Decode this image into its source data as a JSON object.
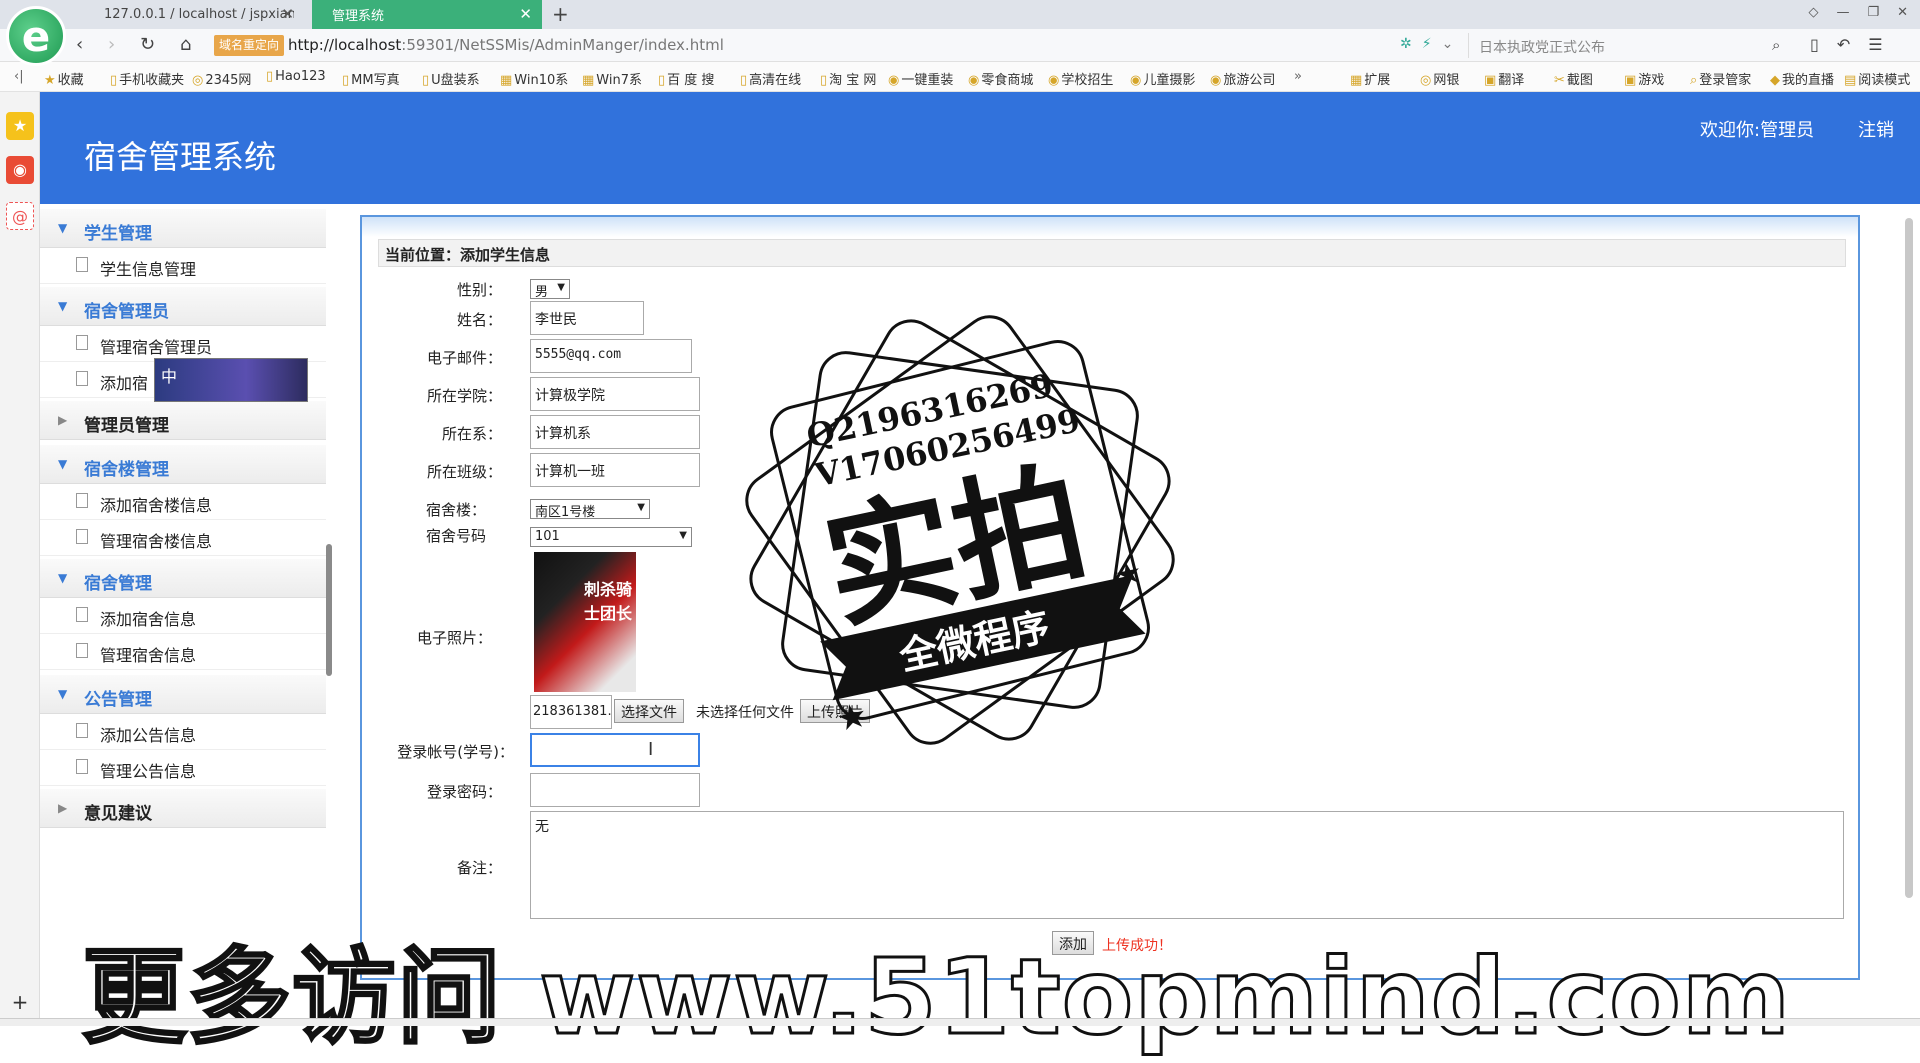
{
  "browser": {
    "tabs": [
      {
        "label": "127.0.0.1 / localhost / jspxian"
      },
      {
        "label": "管理系统"
      }
    ],
    "redirect_badge": "域名重定向",
    "url_host": "http://localhost",
    "url_rest": ":59301/NetSSMis/AdminManger/index.html",
    "search_placeholder": "日本执政党正式公布",
    "bookmarks": [
      "收藏",
      "手机收藏夹",
      "2345网",
      "Hao123",
      "MM写真",
      "U盘装系",
      "Win10系",
      "Win7系",
      "百 度 搜",
      "高清在线",
      "淘 宝 网",
      "一键重装",
      "零食商城",
      "学校招生",
      "儿童摄影",
      "旅游公司",
      "扩展",
      "网银",
      "翻译",
      "截图",
      "游戏",
      "登录管家",
      "我的直播",
      "阅读模式"
    ]
  },
  "app": {
    "title": "宿舍管理系统",
    "welcome": "欢迎你:管理员",
    "logout": "注销"
  },
  "sidebar": {
    "groups": [
      {
        "label": "学生管理",
        "items": [
          "学生信息管理"
        ]
      },
      {
        "label": "宿舍管理员",
        "items": [
          "管理宿舍管理员",
          "添加宿"
        ]
      },
      {
        "label": "管理员管理",
        "items": []
      },
      {
        "label": "宿舍楼管理",
        "items": [
          "添加宿舍楼信息",
          "管理宿舍楼信息"
        ]
      },
      {
        "label": "宿舍管理",
        "items": [
          "添加宿舍信息",
          "管理宿舍信息"
        ]
      },
      {
        "label": "公告管理",
        "items": [
          "添加公告信息",
          "管理公告信息"
        ]
      },
      {
        "label": "意见建议",
        "items": []
      }
    ],
    "ime_label": "中"
  },
  "form": {
    "breadcrumb": "当前位置：添加学生信息",
    "gender_label": "性别：",
    "gender_value": "男",
    "name_label": "姓名：",
    "name_value": "李世民",
    "email_label": "电子邮件：",
    "email_value": "5555@qq.com",
    "college_label": "所在学院：",
    "college_value": "计算极学院",
    "dept_label": "所在系：",
    "dept_value": "计算机系",
    "class_label": "所在班级：",
    "class_value": "计算机一班",
    "building_label": "宿舍楼：",
    "building_value": "南区1号楼",
    "room_label": "宿舍号码",
    "room_value": "101",
    "photo_label": "电子照片：",
    "photo_caption": "刺杀骑士团长",
    "photo_filename": "218361381.",
    "choose_file": "选择文件",
    "no_file": "未选择任何文件",
    "upload_button": "上传照片",
    "account_label": "登录帐号(学号)：",
    "account_value": "",
    "password_label": "登录密码：",
    "password_value": "",
    "remark_label": "备注：",
    "remark_value": "无",
    "add_button": "添加",
    "upload_success": "上传成功！"
  },
  "overlay": {
    "stamp_line1": "Q2196316269",
    "stamp_line2": "V17060256499",
    "stamp_main": "实拍",
    "stamp_banner": "全微程序",
    "watermark": "更多访问 www.51topmind.com"
  }
}
